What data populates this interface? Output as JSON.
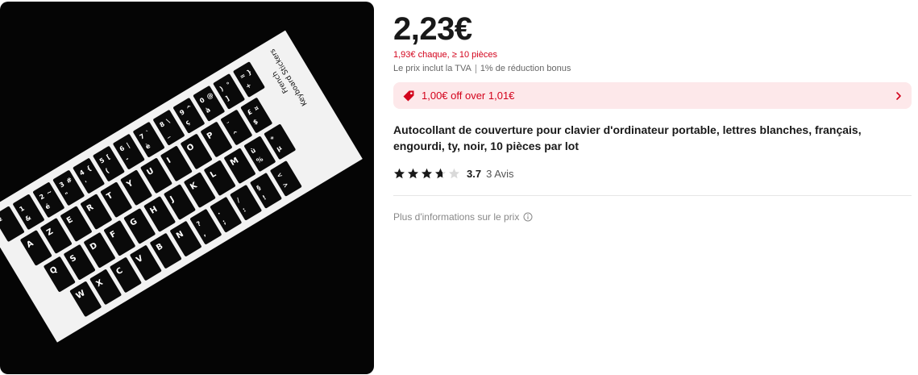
{
  "product": {
    "price": "2,23€",
    "bulk_price": "1,93€ chaque, ≥ 10 pièces",
    "tax_note": "Le prix inclut la TVA",
    "bonus_note": "1% de réduction bonus",
    "coupon_text": "1,00€ off over 1,01€",
    "title": "Autocollant de couverture pour clavier d'ordinateur portable, lettres blanches, français, engourdi, ty, noir, 10 pièces par lot",
    "rating_value": "3.7",
    "review_count": "3 Avis",
    "rating_stars": 3.7,
    "more_info": "Plus d'informations sur le prix"
  },
  "sticker": {
    "header_lines": [
      "French",
      "Keyboard Stickers"
    ],
    "rows": [
      [
        "²",
        "1 &",
        "2 é ~",
        "3 \" #",
        "4 ' {",
        "5 ( [",
        "6 - |",
        "7 è `",
        "8 _ \\",
        "9 ç ^",
        "0 à @",
        ") ] °",
        "= + }"
      ],
      [
        "A",
        "Z",
        "E",
        "R",
        "T",
        "Y",
        "U",
        "I",
        "O",
        "P",
        "¨ ^",
        "£ $ ¤"
      ],
      [
        "Q",
        "S",
        "D",
        "F",
        "G",
        "H",
        "J",
        "K",
        "L",
        "M",
        "ù %",
        "* µ"
      ],
      [
        "W",
        "X",
        "C",
        "V",
        "B",
        "N",
        "? ,",
        ". ;",
        "/ :",
        "§ !",
        "< >"
      ]
    ]
  },
  "colors": {
    "accent_red": "#d3031c",
    "coupon_bg": "#fde8ea",
    "star": "#191919"
  },
  "icons": {
    "coupon": "price-tag-icon",
    "chevron": "chevron-right-icon",
    "star": "star-icon",
    "info": "info-circle-icon"
  }
}
